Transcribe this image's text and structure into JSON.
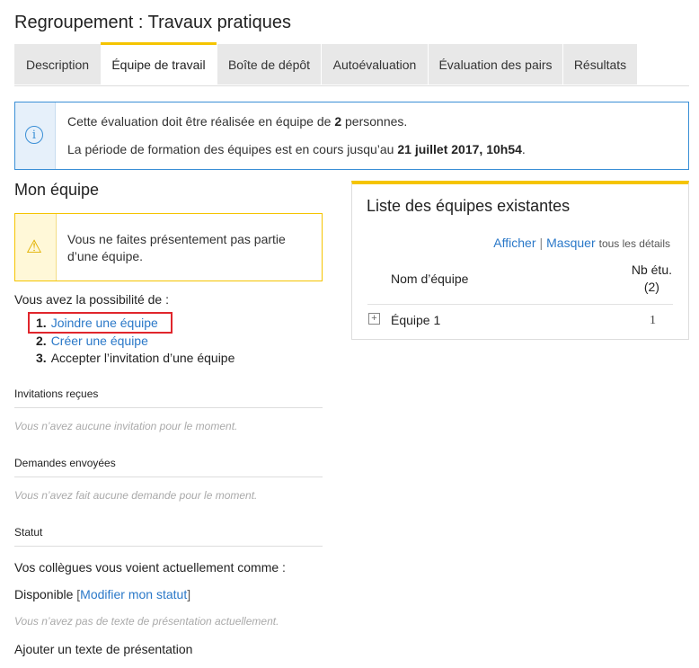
{
  "page_title": "Regroupement : Travaux pratiques",
  "tabs": [
    {
      "label": "Description",
      "active": false
    },
    {
      "label": "Équipe de travail",
      "active": true
    },
    {
      "label": "Boîte de dépôt",
      "active": false
    },
    {
      "label": "Autoévaluation",
      "active": false
    },
    {
      "label": "Évaluation des pairs",
      "active": false
    },
    {
      "label": "Résultats",
      "active": false
    }
  ],
  "info": {
    "icon": "info-icon",
    "line1_prefix": "Cette évaluation doit être réalisée en équipe de ",
    "line1_bold": "2",
    "line1_suffix": " personnes.",
    "line2_prefix": "La période de formation des équipes est en cours jusqu’au ",
    "line2_bold": "21 juillet 2017, 10h54",
    "line2_suffix": "."
  },
  "my_team": {
    "title": "Mon équipe",
    "warning_icon": "warning-icon",
    "warning_text": "Vous ne faites présentement pas partie d’une équipe.",
    "possibility_label": "Vous avez la possibilité de :",
    "options": [
      {
        "num": "1.",
        "label": "Joindre une équipe"
      },
      {
        "num": "2.",
        "label": "Créer une équipe"
      },
      {
        "num": "3.",
        "label": "Accepter l’invitation d’une équipe"
      }
    ],
    "invitations_title": "Invitations reçues",
    "invitations_empty": "Vous n’avez aucune invitation pour le moment.",
    "requests_title": "Demandes envoyées",
    "requests_empty": "Vous n’avez fait aucune demande pour le moment.",
    "status_title": "Statut",
    "status_intro": "Vos collègues vous voient actuellement comme :",
    "status_value": "Disponible",
    "status_bracket_open": "[",
    "status_modify": "Modifier mon statut",
    "status_bracket_close": "]",
    "presentation_empty": "Vous n’avez pas de texte de présentation actuellement.",
    "add_presentation": "Ajouter un texte de présentation"
  },
  "team_list": {
    "title": "Liste des équipes existantes",
    "show_label": "Afficher",
    "separator": "|",
    "hide_label": "Masquer",
    "details_label": "tous les détails",
    "col_name": "Nom d’équipe",
    "col_nb_line1": "Nb étu.",
    "col_nb_line2": "(2)",
    "expand_icon": "plus-square-icon",
    "teams": [
      {
        "name": "Équipe 1",
        "count": "1"
      }
    ]
  },
  "colors": {
    "accent_yellow": "#f5c400",
    "link_blue": "#2a78c8",
    "info_blue": "#3a8fd6",
    "highlight_red": "#e0262c"
  }
}
